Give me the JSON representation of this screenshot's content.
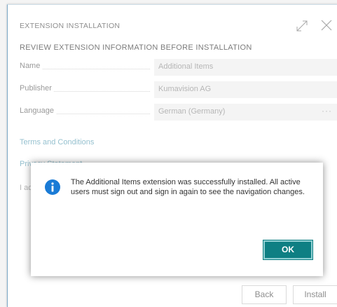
{
  "window": {
    "title": "EXTENSION INSTALLATION"
  },
  "section": {
    "heading": "REVIEW EXTENSION INFORMATION BEFORE INSTALLATION"
  },
  "fields": [
    {
      "label": "Name",
      "value": "Additional Items"
    },
    {
      "label": "Publisher",
      "value": "Kumavision AG"
    },
    {
      "label": "Language",
      "value": "German (Germany)",
      "ellipsis": "···"
    }
  ],
  "links": {
    "terms": "Terms and Conditions",
    "privacy": "Privacy Statement"
  },
  "agree_text": "I ac",
  "buttons": {
    "back": "Back",
    "install": "Install"
  },
  "dialog": {
    "icon": "info-icon",
    "message": "The Additional Items extension was successfully installed. All active users must sign out and sign in again to see the navigation changes.",
    "ok_label": "OK"
  },
  "colors": {
    "accent": "#0e7f83",
    "info_icon": "#1a7bd6",
    "link": "#5c9fb5"
  }
}
